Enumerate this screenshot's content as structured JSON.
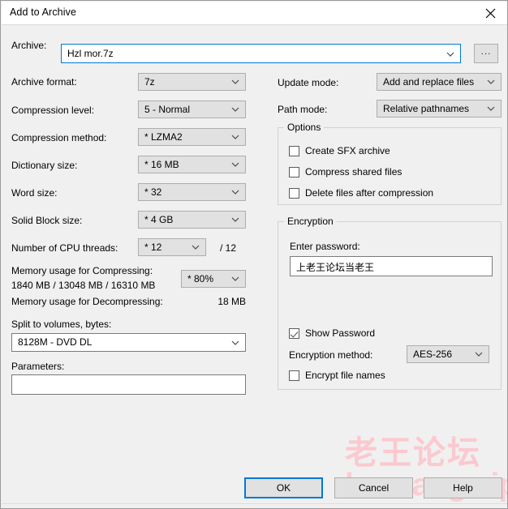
{
  "window": {
    "title": "Add to Archive",
    "close_icon": "close-icon"
  },
  "archive": {
    "label": "Archive:",
    "value": "Hzl mor.7z",
    "browse_label": "..."
  },
  "left_column": {
    "archive_format": {
      "label": "Archive format:",
      "value": "7z"
    },
    "compression_level": {
      "label": "Compression level:",
      "value": "5 - Normal"
    },
    "compression_method": {
      "label": "Compression method:",
      "value": "*  LZMA2"
    },
    "dictionary_size": {
      "label": "Dictionary size:",
      "value": "*  16 MB"
    },
    "word_size": {
      "label": "Word size:",
      "value": "*  32"
    },
    "solid_block_size": {
      "label": "Solid Block size:",
      "value": "*  4 GB"
    },
    "cpu_threads": {
      "label": "Number of CPU threads:",
      "value": "*  12",
      "total": "/ 12"
    },
    "memory_compress": {
      "label": "Memory usage for Compressing:",
      "detail": "1840 MB / 13048 MB / 16310 MB",
      "percent": "*  80%"
    },
    "memory_decompress": {
      "label": "Memory usage for Decompressing:",
      "value": "18 MB"
    },
    "split_volumes": {
      "label": "Split to volumes, bytes:",
      "value": "8128M - DVD DL"
    },
    "parameters": {
      "label": "Parameters:",
      "value": ""
    }
  },
  "right_column": {
    "update_mode": {
      "label": "Update mode:",
      "value": "Add and replace files"
    },
    "path_mode": {
      "label": "Path mode:",
      "value": "Relative pathnames"
    },
    "options": {
      "title": "Options",
      "items": [
        {
          "label": "Create SFX archive",
          "checked": false
        },
        {
          "label": "Compress shared files",
          "checked": false
        },
        {
          "label": "Delete files after compression",
          "checked": false
        }
      ]
    },
    "encryption": {
      "title": "Encryption",
      "password_label": "Enter password:",
      "password_value": "上老王论坛当老王",
      "show_password": {
        "label": "Show Password",
        "checked": true
      },
      "method_label": "Encryption method:",
      "method_value": "AES-256",
      "encrypt_names": {
        "label": "Encrypt file names",
        "checked": false
      }
    }
  },
  "buttons": {
    "ok": "OK",
    "cancel": "Cancel",
    "help": "Help"
  },
  "watermark": {
    "chinese": "老王论坛",
    "latin": "laowang.vip",
    "color": "#fbc9cf"
  }
}
